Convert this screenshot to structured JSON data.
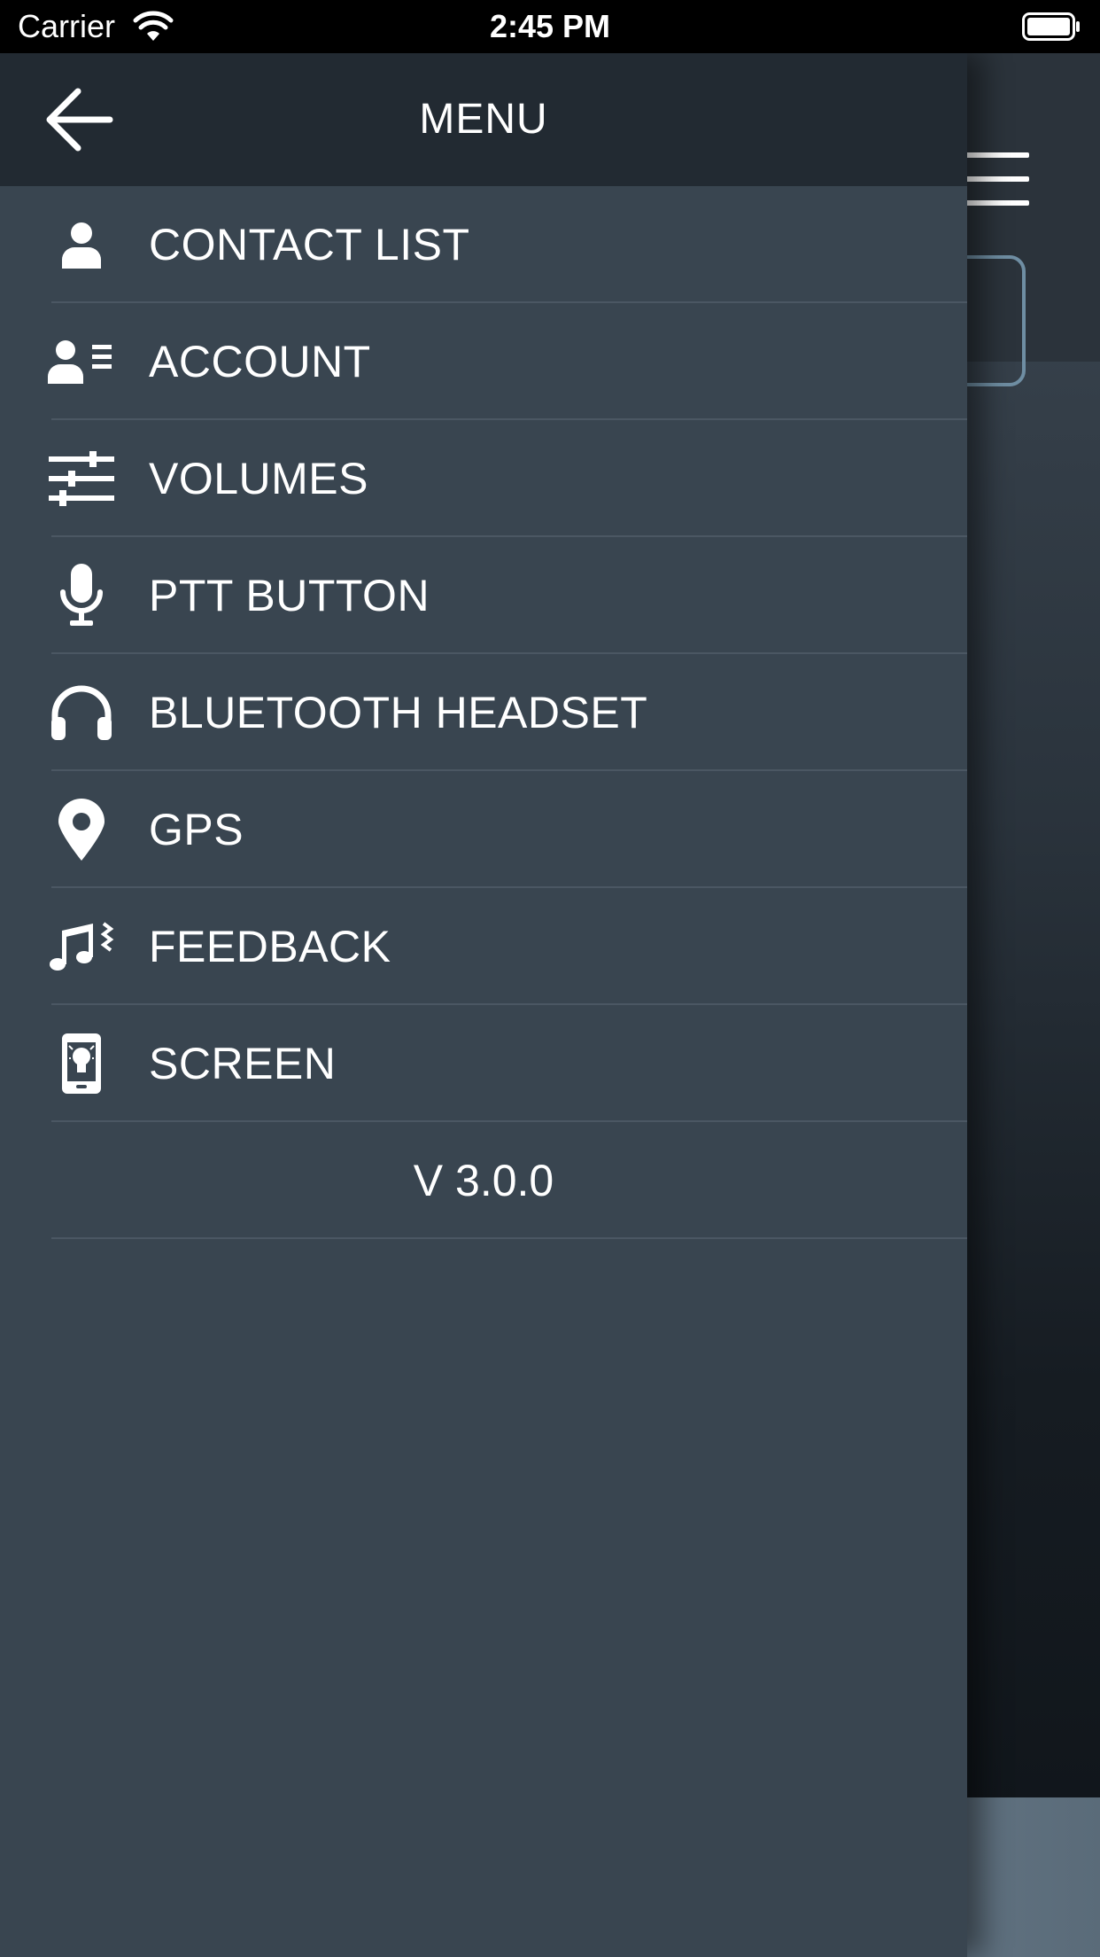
{
  "status_bar": {
    "carrier": "Carrier",
    "time": "2:45 PM"
  },
  "drawer": {
    "title": "MENU",
    "items": [
      {
        "label": "CONTACT LIST",
        "icon": "person-icon"
      },
      {
        "label": "ACCOUNT",
        "icon": "account-card-icon"
      },
      {
        "label": "VOLUMES",
        "icon": "sliders-icon"
      },
      {
        "label": "PTT BUTTON",
        "icon": "microphone-icon"
      },
      {
        "label": "BLUETOOTH HEADSET",
        "icon": "headphones-icon"
      },
      {
        "label": "GPS",
        "icon": "location-pin-icon"
      },
      {
        "label": "FEEDBACK",
        "icon": "music-vibrate-icon"
      },
      {
        "label": "SCREEN",
        "icon": "phone-lightbulb-icon"
      }
    ],
    "version": "V 3.0.0"
  },
  "colors": {
    "drawer_background": "#394550",
    "drawer_header": "#222a32",
    "divider": "#4b5763",
    "text": "#ffffff",
    "status_bar": "#000000"
  }
}
